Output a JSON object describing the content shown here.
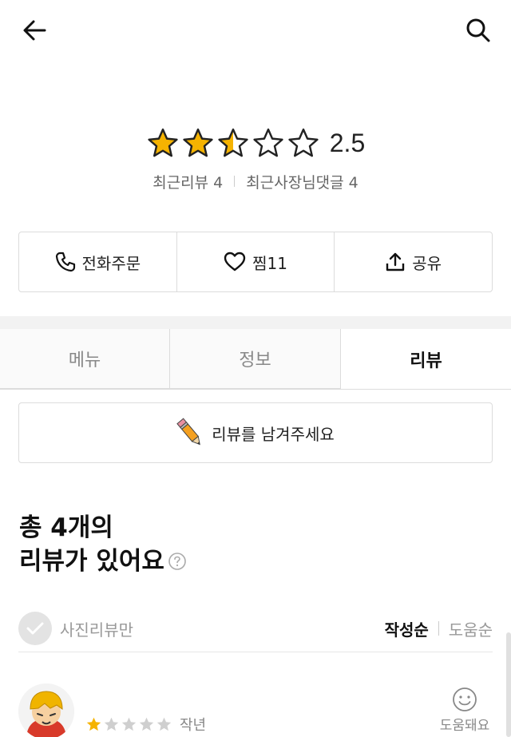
{
  "header": {
    "back_icon": "arrow-left-icon",
    "search_icon": "search-icon"
  },
  "store": {
    "name": "",
    "rating": "2.5",
    "rating_value": 2.5,
    "rating_max": 5,
    "recent_reviews_label": "최근리뷰 4",
    "recent_owner_replies_label": "최근사장님댓글 4",
    "star_color": "#f5b301"
  },
  "actions": {
    "call_label": "전화주문",
    "call_icon": "phone-icon",
    "favorite_label": "찜11",
    "favorite_icon": "heart-icon",
    "share_label": "공유",
    "share_icon": "share-icon"
  },
  "tabs": [
    {
      "label": "메뉴",
      "active": false
    },
    {
      "label": "정보",
      "active": false
    },
    {
      "label": "리뷰",
      "active": true
    }
  ],
  "write_review": {
    "label": "리뷰를 남겨주세요",
    "icon": "pencil-icon"
  },
  "reviews_summary": {
    "line1": "총 4개의",
    "line2": "리뷰가 있어요",
    "help_icon": "question-circle-icon"
  },
  "filters": {
    "photo_only_label": "사진리뷰만",
    "sort_latest": "작성순",
    "sort_helpful": "도움순"
  },
  "review": {
    "reviewer_name": "",
    "rating_value": 1,
    "rating_max": 5,
    "date": "작년",
    "helpful_label": "도움돼요",
    "helpful_icon": "smile-icon"
  }
}
